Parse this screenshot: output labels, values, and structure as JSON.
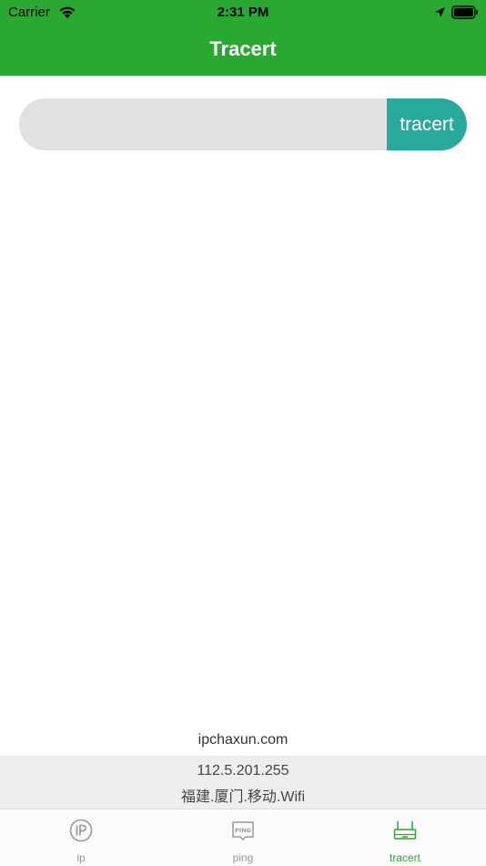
{
  "status_bar": {
    "carrier": "Carrier",
    "time": "2:31 PM"
  },
  "header": {
    "title": "Tracert"
  },
  "search": {
    "placeholder": "",
    "value": "",
    "button_label": "tracert"
  },
  "footer": {
    "site": "ipchaxun.com",
    "ip": "112.5.201.255",
    "location": "福建.厦门.移动.Wifi"
  },
  "tabs": [
    {
      "label": "ip",
      "icon": "ip-icon",
      "active": false
    },
    {
      "label": "ping",
      "icon": "ping-icon",
      "active": false
    },
    {
      "label": "tracert",
      "icon": "router-icon",
      "active": true
    }
  ],
  "colors": {
    "header": "#29a832",
    "button": "#29a99b",
    "active_tab": "#29a832",
    "inactive_tab": "#999999"
  }
}
